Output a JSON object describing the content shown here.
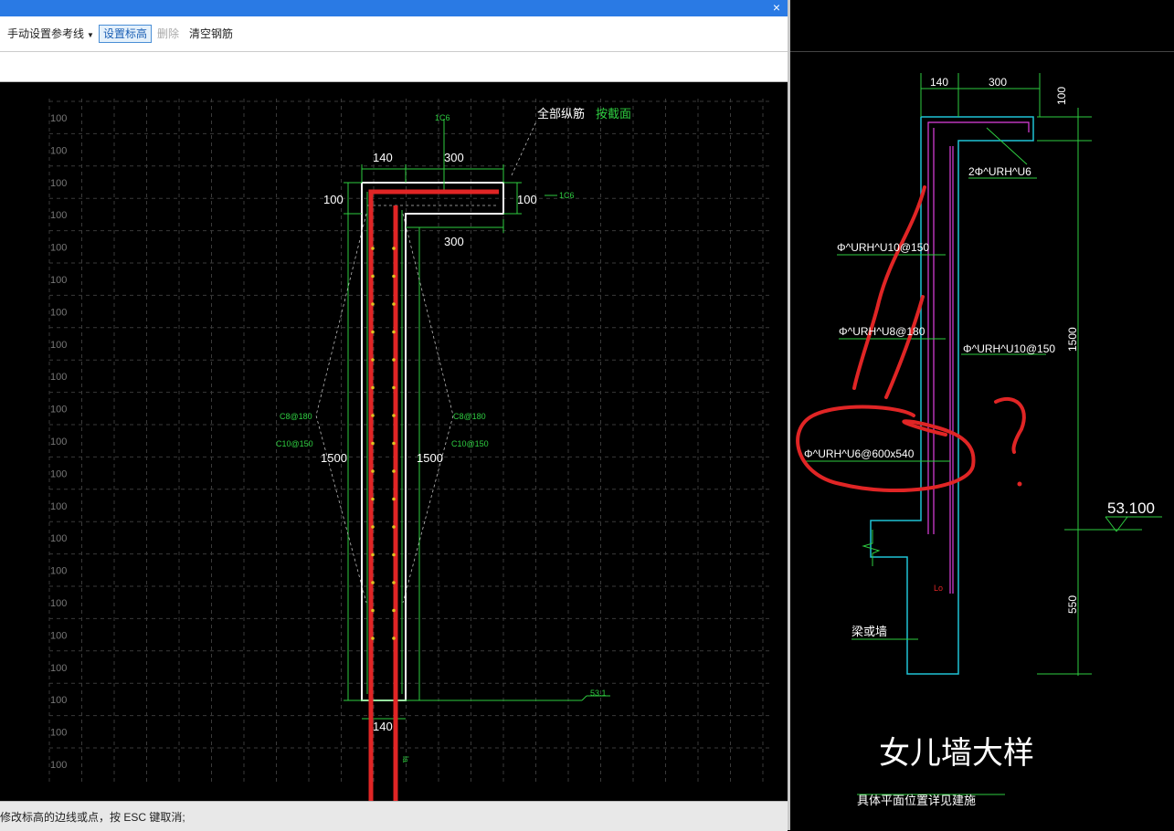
{
  "window": {
    "close_glyph": "×"
  },
  "toolbar": {
    "manual_ref_line": "手动设置参考线",
    "set_elevation": "设置标高",
    "delete": "删除",
    "clear_rebar": "清空钢筋"
  },
  "status": {
    "text": "修改标高的边线或点，按 ESC 键取消;"
  },
  "left_drawing": {
    "grid_label": "100",
    "all_long_rebar": "全部纵筋",
    "by_section": "按截面",
    "dim_140_top": "140",
    "dim_300_top": "300",
    "dim_100_left": "100",
    "dim_100_right": "100",
    "dim_300_lower": "300",
    "dim_1500_left": "1500",
    "dim_1500_right": "1500",
    "dim_140_bottom": "140",
    "label_c6_top": "1C6",
    "label_c6_right": "1C6",
    "label_c8_left": "C8@180",
    "label_c10_left": "C10@150",
    "label_c8_right": "C8@180",
    "label_c10_right": "C10@150",
    "label_la": "la",
    "level_mark": "53.1"
  },
  "right_drawing": {
    "dim_140": "140",
    "dim_300": "300",
    "dim_100": "100",
    "rebar_top": "2Φ^URH^U6",
    "rebar_10_150_left": "Φ^URH^U10@150",
    "rebar_8_180": "Φ^URH^U8@180",
    "rebar_10_150_right": "Φ^URH^U10@150",
    "rebar_6_600": "Φ^URH^U6@600x540",
    "dim_1500": "1500",
    "elevation": "53.100",
    "dim_550": "550",
    "lo_label": "Lo",
    "beam_or_wall": "梁或墙",
    "title": "女儿墙大样",
    "note": "具体平面位置详见建施",
    "question_mark": "?"
  }
}
